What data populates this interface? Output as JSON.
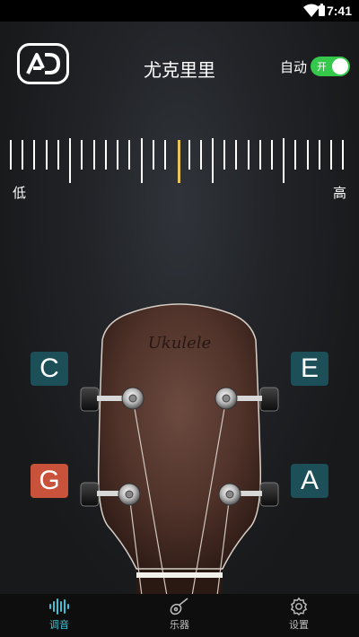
{
  "status_bar": {
    "time": "7:41"
  },
  "header": {
    "title": "尤克里里",
    "auto_label": "自动",
    "toggle_text": "开"
  },
  "ruler": {
    "low_label": "低",
    "high_label": "高"
  },
  "instrument": {
    "brand_label": "Ukulele",
    "strings": {
      "left_top": "C",
      "right_top": "E",
      "left_bottom": "G",
      "right_bottom": "A"
    },
    "selected_string": "G"
  },
  "nav": {
    "tune_label": "调音",
    "instrument_label": "乐器",
    "settings_label": "设置"
  },
  "colors": {
    "accent": "#3fc1d3",
    "toggle_on": "#35c94b",
    "indicator": "#e8c35a",
    "string_button": "#1d4f58",
    "string_button_active": "#c8533a",
    "wood": "#5a3a31"
  },
  "icons": {
    "logo": "ad-logo-icon",
    "wifi": "wifi-icon",
    "battery": "battery-icon",
    "tune": "soundwave-icon",
    "instrument": "guitar-icon",
    "settings": "gear-icon"
  }
}
